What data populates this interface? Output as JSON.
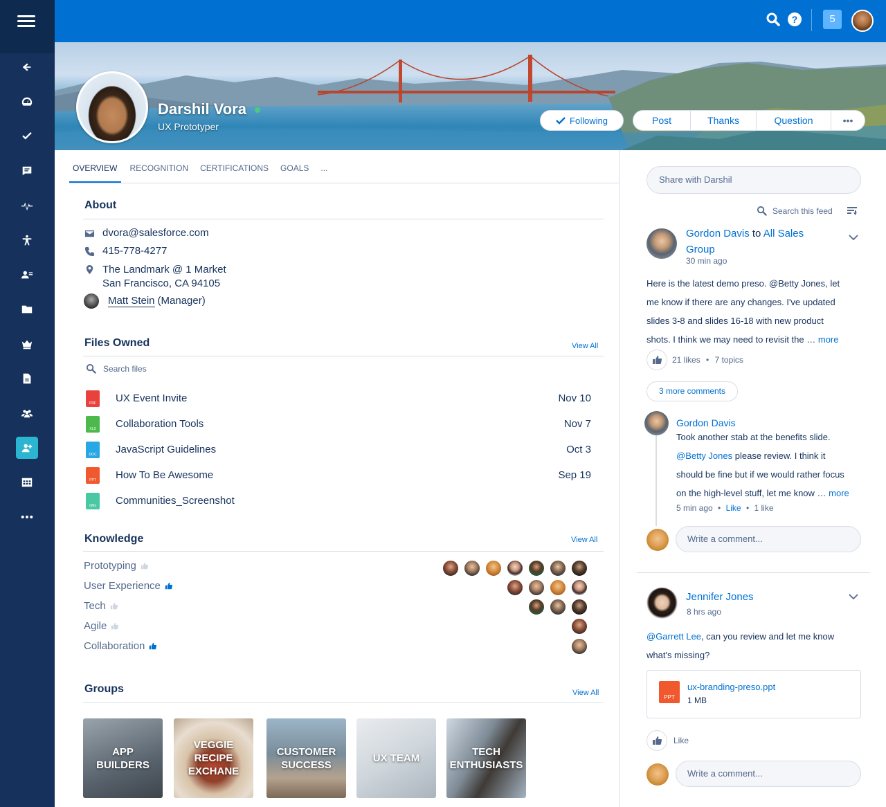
{
  "header": {
    "notification_count": "5"
  },
  "profile": {
    "name": "Darshil Vora",
    "title": "UX Prototyper",
    "follow_label": "Following",
    "actions": [
      "Post",
      "Thanks",
      "Question",
      "•••"
    ]
  },
  "tabs": [
    "OVERVIEW",
    "RECOGNITION",
    "CERTIFICATIONS",
    "GOALS",
    "..."
  ],
  "about": {
    "title": "About",
    "email": "dvora@salesforce.com",
    "phone": "415-778-4277",
    "address_line1": "The Landmark @ 1 Market",
    "address_line2": "San Francisco, CA 94105",
    "manager_name": "Matt Stein",
    "manager_role": "(Manager)"
  },
  "files": {
    "title": "Files Owned",
    "view_all": "View All",
    "search_placeholder": "Search files",
    "items": [
      {
        "name": "UX Event Invite",
        "date": "Nov 10",
        "type": "PDF",
        "color": "#e9423d"
      },
      {
        "name": "Collaboration Tools",
        "date": "Nov 7",
        "type": "XLS",
        "color": "#4bb94b"
      },
      {
        "name": "JavaScript Guidelines",
        "date": "Oct 3",
        "type": "DOC",
        "color": "#27a7e3"
      },
      {
        "name": "How To Be Awesome",
        "date": "Sep 19",
        "type": "PPT",
        "color": "#f0582e"
      },
      {
        "name": "Communities_Screenshot",
        "date": "",
        "type": "IMG",
        "color": "#4ac8a4"
      }
    ]
  },
  "knowledge": {
    "title": "Knowledge",
    "view_all": "View All",
    "items": [
      {
        "topic": "Prototyping",
        "endorsed": false
      },
      {
        "topic": "User Experience",
        "endorsed": true
      },
      {
        "topic": "Tech",
        "endorsed": false
      },
      {
        "topic": "Agile",
        "endorsed": false
      },
      {
        "topic": "Collaboration",
        "endorsed": true
      }
    ]
  },
  "groups": {
    "title": "Groups",
    "view_all": "View All",
    "items": [
      {
        "line1": "APP",
        "line2": "BUILDERS"
      },
      {
        "line1": "VEGGIE",
        "line2": "RECIPE",
        "line3": "EXCHANE"
      },
      {
        "line1": "CUSTOMER",
        "line2": "SUCCESS"
      },
      {
        "line1": "UX TEAM"
      },
      {
        "line1": "TECH",
        "line2": "ENTHUSIASTS"
      }
    ]
  },
  "feed": {
    "share_placeholder": "Share with Darshil",
    "search_label": "Search this feed",
    "post1": {
      "author": "Gordon Davis",
      "to_word": "to",
      "target_line1": "All Sales",
      "target_line2": "Group",
      "time": "30 min ago",
      "body_lines": [
        "Here is the latest demo preso. @Betty Jones, let",
        "me know if there are any changes. I've updated",
        "slides 3-8 and slides 16-18 with new product",
        "shots. I think we may need to revisit the …"
      ],
      "more": "more",
      "likes": "21 likes",
      "dot": "•",
      "topics": "7 topics",
      "more_comments": "3 more comments",
      "comment": {
        "author": "Gordon Davis",
        "line1": "Took another stab at the benefits slide.",
        "mention": "@Betty Jones",
        "line2_rest": " please review. I think it",
        "line3": "should be fine but if we would rather focus",
        "line4": "on the high-level stuff, let me know …",
        "more": "more",
        "time": "5 min ago",
        "like": "Like",
        "likes": "1 like",
        "dot": "•"
      },
      "write_comment": "Write a comment..."
    },
    "post2": {
      "author": "Jennifer Jones",
      "time": "8 hrs ago",
      "mention": "@Garrett Lee",
      "body_line1_rest": ", can you review and let me know",
      "body_line2": "what's missing?",
      "attachment_name": "ux-branding-preso.ppt",
      "attachment_size": "1 MB",
      "attachment_type": "PPT",
      "like": "Like",
      "write_comment": "Write a comment..."
    }
  }
}
